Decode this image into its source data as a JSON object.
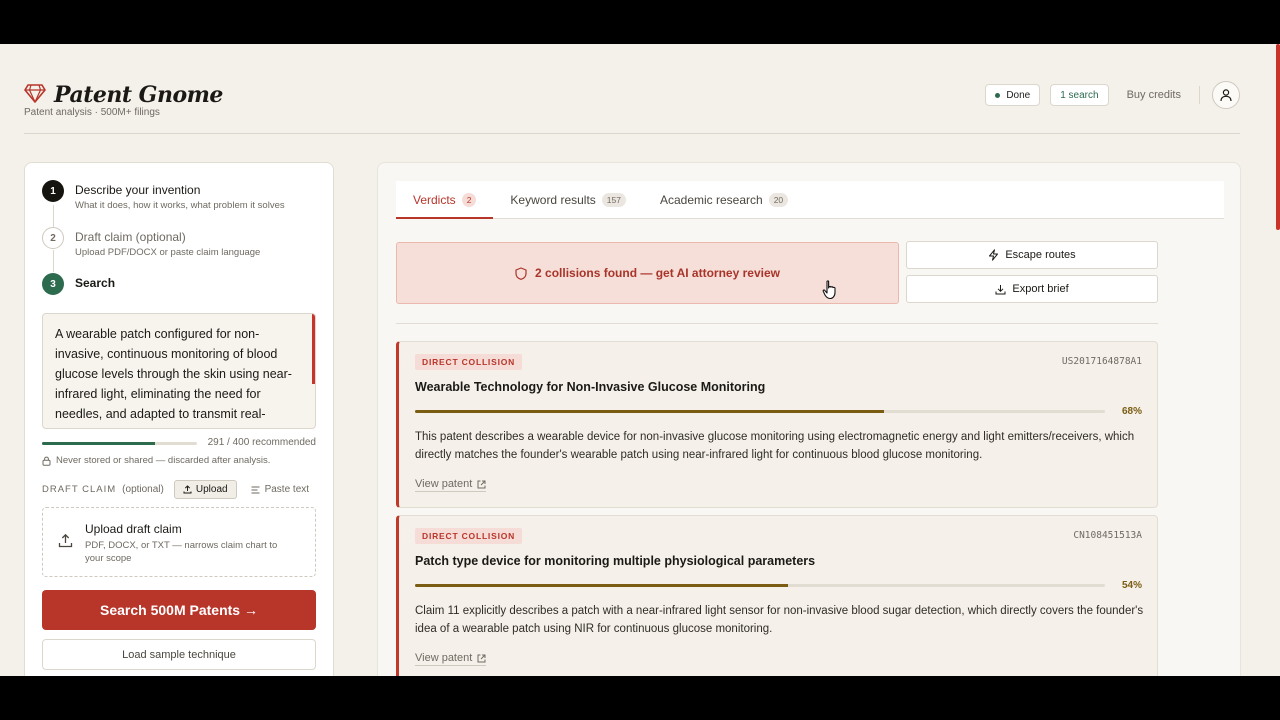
{
  "header": {
    "brand_name": "Patent Gnome",
    "brand_sub": "Patent analysis · 500M+ filings",
    "status_label": "Done",
    "search_count": "1 search",
    "buy_credits": "Buy credits"
  },
  "steps": [
    {
      "num": "1",
      "title": "Describe your invention",
      "subtitle": "What it does, how it works, what problem it solves"
    },
    {
      "num": "2",
      "title": "Draft claim (optional)",
      "subtitle": "Upload PDF/DOCX or paste claim language"
    },
    {
      "num": "3",
      "title": "Search",
      "subtitle": ""
    }
  ],
  "invention": {
    "text": "A wearable patch configured for non-invasive, continuous monitoring of blood glucose levels through the skin using near-infrared light, eliminating the need for needles, and adapted to transmit real-",
    "char_count": "291 / 400 recommended",
    "char_fraction": 0.7275,
    "privacy": "Never stored or shared — discarded after analysis."
  },
  "draft_claim": {
    "label": "DRAFT CLAIM",
    "optional": "(optional)",
    "upload_label": "Upload",
    "paste_label": "Paste text",
    "dropzone_title": "Upload draft claim",
    "dropzone_sub": "PDF, DOCX, or TXT — narrows claim chart to your scope"
  },
  "actions": {
    "search_button": "Search 500M Patents →",
    "sample_button": "Load sample technique"
  },
  "tabs": [
    {
      "label": "Verdicts",
      "count": "2",
      "active": true
    },
    {
      "label": "Keyword results",
      "count": "157",
      "active": false
    },
    {
      "label": "Academic research",
      "count": "20",
      "active": false
    }
  ],
  "alert": {
    "text": "2 collisions found — get AI attorney review"
  },
  "side_actions": {
    "escape": "Escape routes",
    "export": "Export brief"
  },
  "results": [
    {
      "tag": "DIRECT COLLISION",
      "patent_id": "US2017164878A1",
      "title": "Wearable Technology for Non-Invasive Glucose Monitoring",
      "score": 0.68,
      "score_label": "68%",
      "description": "This patent describes a wearable device for non-invasive glucose monitoring using electromagnetic energy and light emitters/receivers, which directly matches the founder's wearable patch using near-infrared light for continuous blood glucose monitoring.",
      "link": "View patent"
    },
    {
      "tag": "DIRECT COLLISION",
      "patent_id": "CN108451513A",
      "title": "Patch type device for monitoring multiple physiological parameters",
      "score": 0.54,
      "score_label": "54%",
      "description": "Claim 11 explicitly describes a patch with a near-infrared light sensor for non-invasive blood sugar detection, which directly covers the founder's idea of a wearable patch using NIR for continuous glucose monitoring.",
      "link": "View patent"
    }
  ],
  "colors": {
    "accent": "#b8352a",
    "success": "#2d6b4f",
    "score": "#7a5c12",
    "background": "#f4f1eb"
  }
}
